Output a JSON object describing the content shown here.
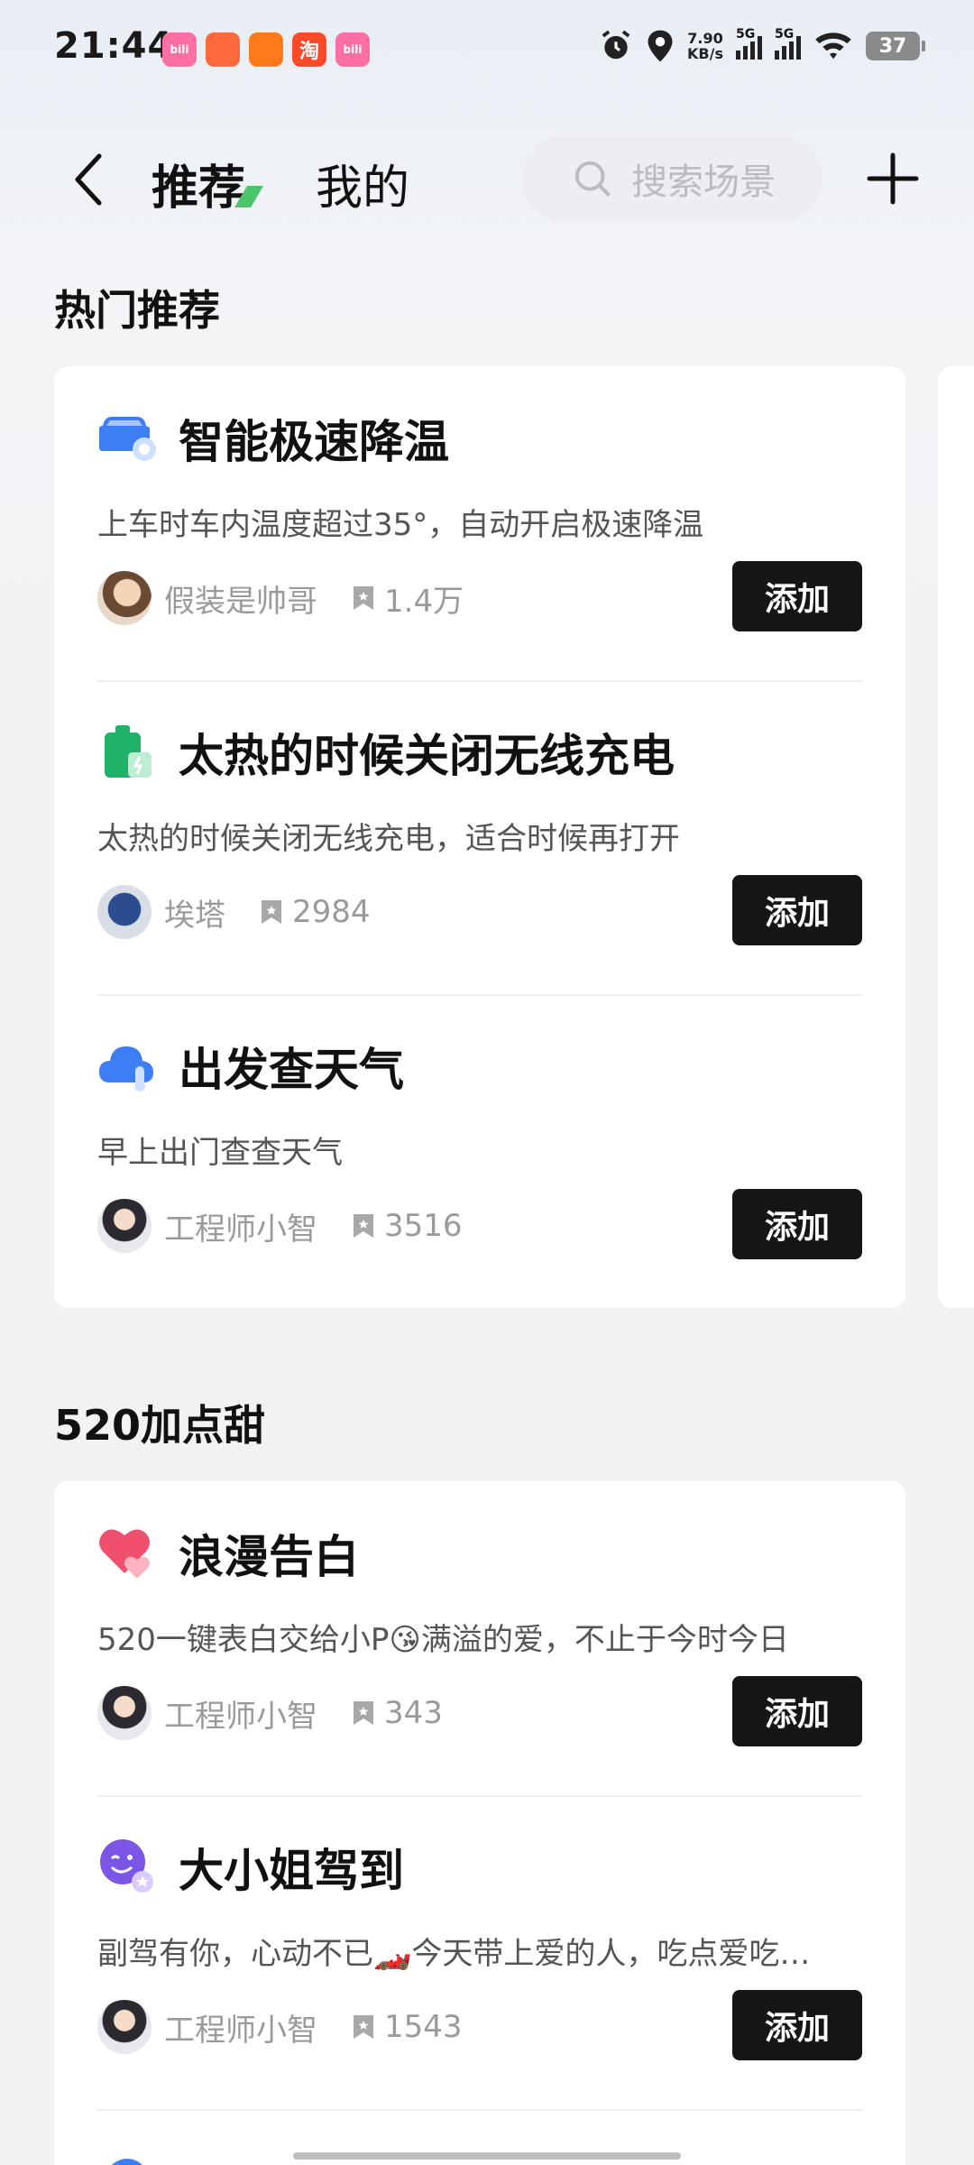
{
  "status_bar": {
    "time": "21:44",
    "net_speed_value": "7.90",
    "net_speed_unit": "KB/s",
    "signal1_label": "5G",
    "signal2_label": "5G",
    "battery": "37",
    "app_icons": [
      {
        "name": "bilibili-icon",
        "color": "#ff6fa4",
        "label": "bili"
      },
      {
        "name": "app-promo-icon",
        "color": "#ff6a3d",
        "label": ""
      },
      {
        "name": "app-orange-icon",
        "color": "#ff7a1a",
        "label": ""
      },
      {
        "name": "taobao-icon",
        "color": "#ff4a2a",
        "label": "淘"
      },
      {
        "name": "bilibili-icon-2",
        "color": "#ff6fa4",
        "label": "bili"
      }
    ]
  },
  "header": {
    "tab_recommend": "推荐",
    "tab_mine": "我的",
    "search_placeholder": "搜索场景",
    "accent_color": "#4cc46a"
  },
  "sections": [
    {
      "title": "热门推荐",
      "items": [
        {
          "icon": "car-cooling-icon",
          "title": "智能极速降温",
          "desc": "上车时车内温度超过35°，自动开启极速降温",
          "author": "假装是帅哥",
          "count": "1.4万",
          "button": "添加"
        },
        {
          "icon": "wireless-charging-icon",
          "title": "太热的时候关闭无线充电",
          "desc": "太热的时候关闭无线充电，适合时候再打开",
          "author": "埃塔",
          "count": "2984",
          "button": "添加"
        },
        {
          "icon": "weather-cloud-icon",
          "title": "出发查天气",
          "desc": "早上出门查查天气",
          "author": "工程师小智",
          "count": "3516",
          "button": "添加"
        }
      ]
    },
    {
      "title": "520加点甜",
      "items": [
        {
          "icon": "heart-icon",
          "title": "浪漫告白",
          "desc": "520一键表白交给小P😘满溢的爱，不止于今时今日",
          "author": "工程师小智",
          "count": "343",
          "button": "添加"
        },
        {
          "icon": "wink-face-icon",
          "title": "大小姐驾到",
          "desc": "副驾有你，心动不已🏎️今天带上爱的人，吃点爱吃…",
          "author": "工程师小智",
          "count": "1543",
          "button": "添加"
        }
      ]
    }
  ]
}
